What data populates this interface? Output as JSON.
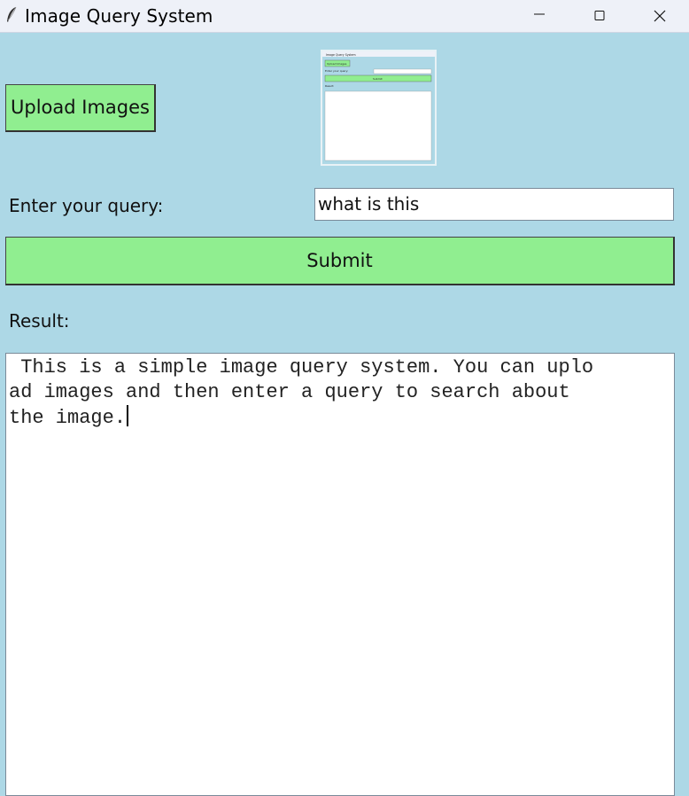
{
  "window": {
    "title": "Image Query System",
    "icon": "feather-icon",
    "controls": [
      "minimize-icon",
      "maximize-icon",
      "close-icon"
    ]
  },
  "upload": {
    "label": "Upload Images"
  },
  "preview": {
    "title": "Image Query System",
    "upload_label": "Upload Images",
    "query_label": "Enter your query:",
    "submit_label": "Submit",
    "result_label": "Result:"
  },
  "query": {
    "label": "Enter your query:",
    "value": "what is this"
  },
  "submit": {
    "label": "Submit"
  },
  "result": {
    "label": "Result:",
    "lines": [
      " This is a simple image query system. You can uplo",
      "ad images and then enter a query to search about",
      "the image."
    ]
  },
  "colors": {
    "background": "#add8e6",
    "button": "#90ee90",
    "titlebar": "#eef1f8",
    "field": "#ffffff"
  }
}
